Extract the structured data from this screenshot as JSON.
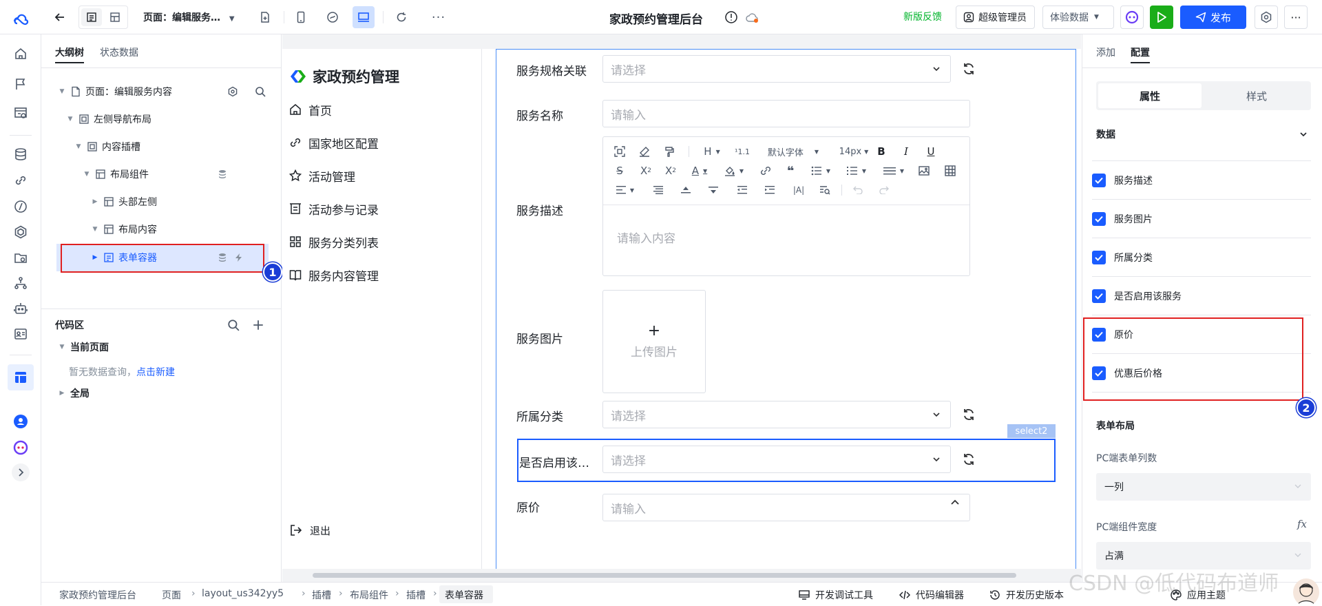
{
  "topbar": {
    "page_selector": "页面：编辑服务…",
    "app_title": "家政预约管理后台",
    "feedback": "新版反馈",
    "admin": "超级管理员",
    "data_mode": "体验数据",
    "publish": "发布"
  },
  "outline": {
    "tabs": [
      "大纲树",
      "状态数据"
    ],
    "tree": [
      "页面：编辑服务内容",
      "左侧导航布局",
      "内容插槽",
      "布局组件",
      "头部左侧",
      "布局内容",
      "表单容器"
    ],
    "code_section": "代码区",
    "current_page": "当前页面",
    "empty_text": "暂无数据查询，",
    "create_link": "点击新建",
    "global": "全局"
  },
  "canvas": {
    "brand": "家政预约管理",
    "nav": [
      "首页",
      "国家地区配置",
      "活动管理",
      "活动参与记录",
      "服务分类列表",
      "服务内容管理"
    ],
    "logout": "退出"
  },
  "form": {
    "spec_label": "服务规格关联",
    "spec_placeholder": "请选择",
    "name_label": "服务名称",
    "name_placeholder": "请输入",
    "desc_label": "服务描述",
    "rte_font": "默认字体",
    "rte_size": "14px",
    "rte_placeholder": "请输入内容",
    "image_label": "服务图片",
    "upload_plus": "+",
    "upload_text": "上传图片",
    "category_label": "所属分类",
    "category_placeholder": "请选择",
    "select_tag": "select2",
    "enable_label": "是否启用该…",
    "enable_placeholder": "请选择",
    "next_label": "原价",
    "next_placeholder": "请输入"
  },
  "right": {
    "tabs": [
      "添加",
      "配置"
    ],
    "segments": [
      "属性",
      "样式"
    ],
    "data_section": "数据",
    "fields": [
      "服务描述",
      "服务图片",
      "所属分类",
      "是否启用该服务",
      "原价",
      "优惠后价格"
    ],
    "layout_section": "表单布局",
    "pc_cols_label": "PC端表单列数",
    "pc_cols_value": "一列",
    "pc_width_label": "PC端组件宽度",
    "fx": "fx",
    "pc_width_value": "占满"
  },
  "bottom": {
    "crumbs": [
      "家政预约管理后台",
      "页面",
      "layout_us342yy5",
      "插槽",
      "布局组件",
      "插槽",
      "表单容器"
    ],
    "debug": "开发调试工具",
    "code_editor": "代码编辑器",
    "history": "开发历史版本",
    "theme": "应用主题"
  },
  "annotations": {
    "badge1": "1",
    "badge2": "2"
  },
  "watermark": "CSDN @低代码布道师",
  "colors": {
    "primary": "#1a5cff",
    "run_green": "#1aad19",
    "feedback_green": "#00b42a",
    "highlight_red": "#e02020"
  }
}
